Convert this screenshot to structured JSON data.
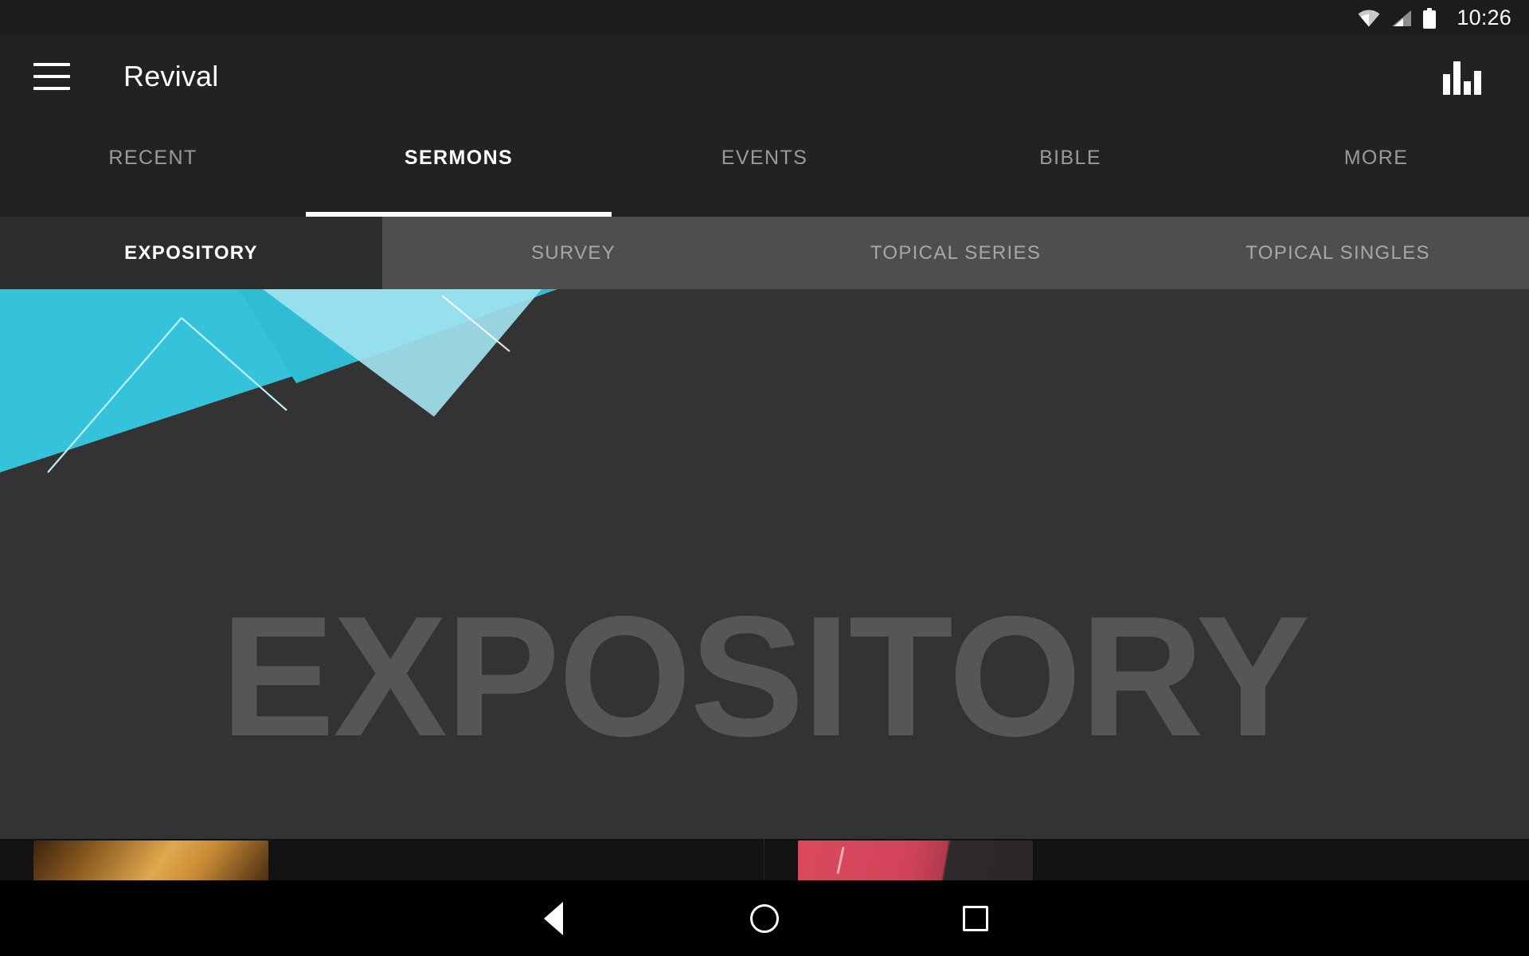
{
  "status_bar": {
    "time": "10:26",
    "icons": [
      "wifi-icon",
      "cellular-signal-icon",
      "battery-icon"
    ]
  },
  "app_bar": {
    "menu_icon": "hamburger-menu-icon",
    "title": "Revival",
    "action_icon": "bar-chart-icon"
  },
  "primary_tabs": {
    "active_index": 1,
    "items": [
      {
        "label": "RECENT"
      },
      {
        "label": "SERMONS"
      },
      {
        "label": "EVENTS"
      },
      {
        "label": "BIBLE"
      },
      {
        "label": "MORE"
      }
    ]
  },
  "secondary_tabs": {
    "active_index": 0,
    "items": [
      {
        "label": "EXPOSITORY"
      },
      {
        "label": "SURVEY"
      },
      {
        "label": "TOPICAL SERIES"
      },
      {
        "label": "TOPICAL SINGLES"
      }
    ]
  },
  "hero": {
    "watermark": "EXPOSITORY",
    "background_color": "#333333",
    "accent_color": "#35c3dc",
    "accent_light_color": "#9fe2ee",
    "watermark_color": "#565656"
  },
  "nav_bar": {
    "back": "back-triangle-icon",
    "home": "home-circle-icon",
    "recents": "recents-square-icon"
  },
  "cards": [
    {
      "name": "sermon-card-1",
      "accent": "#e0a94e"
    },
    {
      "name": "sermon-card-2",
      "accent": "#d94a5c"
    }
  ]
}
